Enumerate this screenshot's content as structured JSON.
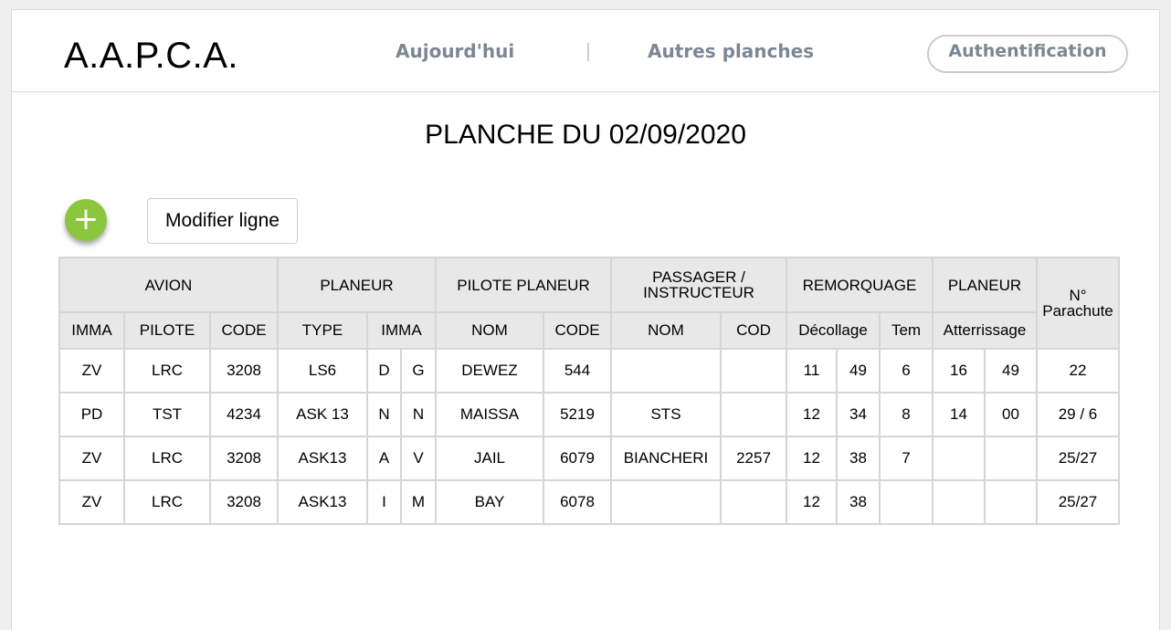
{
  "header": {
    "logo": "A.A.P.C.A.",
    "nav_today": "Aujourd'hui",
    "nav_other": "Autres planches",
    "auth": "Authentification"
  },
  "main": {
    "title": "PLANCHE DU 02/09/2020",
    "add_symbol": "+",
    "modify_label": "Modifier ligne"
  },
  "table": {
    "groups": [
      "AVION",
      "PLANEUR",
      "PILOTE PLANEUR",
      "PASSAGER / INSTRUCTEUR",
      "REMORQUAGE",
      "PLANEUR",
      "N° Parachute"
    ],
    "subheaders": [
      "IMMA",
      "PILOTE",
      "CODE",
      "TYPE",
      "IMMA",
      "NOM",
      "CODE",
      "NOM",
      "COD",
      "Décollage",
      "Tem",
      "Atterrissage"
    ],
    "rows": [
      [
        "ZV",
        "LRC",
        "3208",
        "LS6",
        "D",
        "G",
        "DEWEZ",
        "544",
        "",
        "",
        "11",
        "49",
        "6",
        "16",
        "49",
        "22"
      ],
      [
        "PD",
        "TST",
        "4234",
        "ASK 13",
        "N",
        "N",
        "MAISSA",
        "5219",
        "STS",
        "",
        "12",
        "34",
        "8",
        "14",
        "00",
        "29 / 6"
      ],
      [
        "ZV",
        "LRC",
        "3208",
        "ASK13",
        "A",
        "V",
        "JAIL",
        "6079",
        "BIANCHERI",
        "2257",
        "12",
        "38",
        "7",
        "",
        "",
        "25/27"
      ],
      [
        "ZV",
        "LRC",
        "3208",
        "ASK13",
        "I",
        "M",
        "BAY",
        "6078",
        "",
        "",
        "12",
        "38",
        "",
        "",
        "",
        "25/27"
      ]
    ]
  }
}
